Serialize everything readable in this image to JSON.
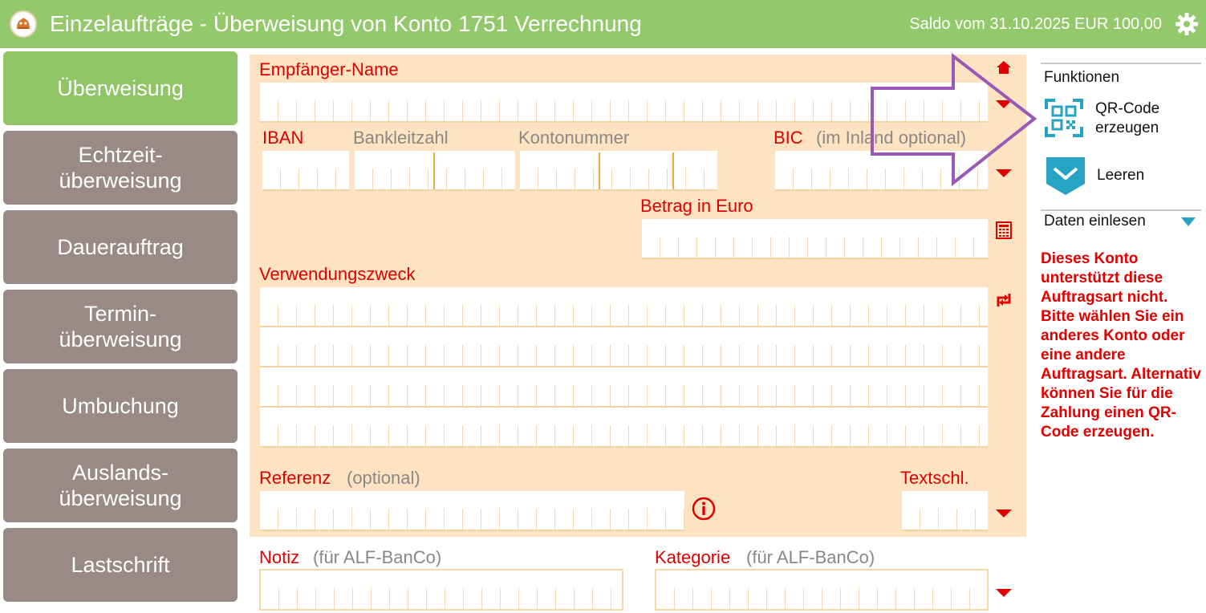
{
  "header": {
    "title": "Einzelaufträge - Überweisung von Konto 1751 Verrechnung",
    "saldo": "Saldo vom 31.10.2025 EUR 100,00",
    "logo_icon": "sparkasse-logo-icon",
    "settings_icon": "gear-icon"
  },
  "nav": {
    "items": [
      {
        "label": "Überweisung",
        "active": true
      },
      {
        "label": "Echtzeit-\nüberweisung",
        "active": false
      },
      {
        "label": "Dauerauftrag",
        "active": false
      },
      {
        "label": "Termin-\nüberweisung",
        "active": false
      },
      {
        "label": "Umbuchung",
        "active": false
      },
      {
        "label": "Auslands-\nüberweisung",
        "active": false
      },
      {
        "label": "Lastschrift",
        "active": false
      }
    ]
  },
  "form": {
    "empfaenger_label": "Empfänger-Name",
    "empfaenger_value": "",
    "iban_label": "IBAN",
    "blz_label": "Bankleitzahl",
    "konto_label": "Kontonummer",
    "bic_label": "BIC",
    "bic_hint": "(im Inland optional)",
    "betrag_label": "Betrag in Euro",
    "verwendung_label": "Verwendungszweck",
    "referenz_label": "Referenz",
    "referenz_hint": "(optional)",
    "textschl_label": "Textschl.",
    "notiz_label": "Notiz",
    "notiz_hint": "(für ALF-BanCo)",
    "kategorie_label": "Kategorie",
    "kategorie_hint": "(für ALF-BanCo)"
  },
  "functions": {
    "title": "Funktionen",
    "qr_label": "QR-Code\nerzeugen",
    "clear_label": "Leeren",
    "import_label": "Daten einlesen",
    "warning": "Dieses Konto unterstützt diese Auftragsart nicht. Bitte wählen Sie ein anderes Konto oder eine andere Auftragsart. Alternativ können Sie für die Zahlung einen QR-Code erzeugen."
  },
  "colors": {
    "header_green": "#93c96a",
    "nav_active": "#8fc565",
    "nav_inactive": "#998a88",
    "panel_bg": "#fde3c2",
    "label_red": "#e00000",
    "annotation_purple": "#9b59b6",
    "icon_teal": "#27a3c4"
  }
}
